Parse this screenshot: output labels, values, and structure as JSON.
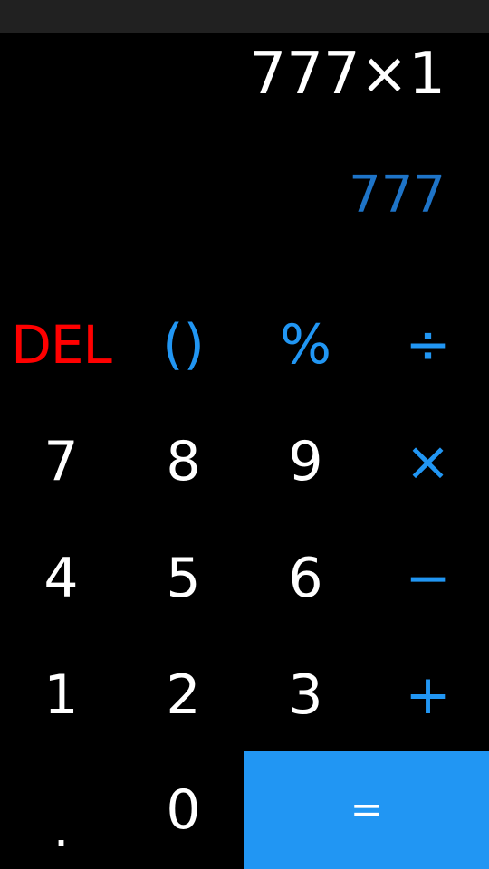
{
  "display": {
    "expression": "777×1",
    "result": "777"
  },
  "keypad": {
    "row1": [
      "DEL",
      "()",
      "%",
      "÷"
    ],
    "row2": [
      "7",
      "8",
      "9",
      "×"
    ],
    "row3": [
      "4",
      "5",
      "6",
      "−"
    ],
    "row4": [
      "1",
      "2",
      "3",
      "+"
    ],
    "row5": [
      ".",
      "0",
      "="
    ]
  },
  "colors": {
    "background": "#000000",
    "status_bar": "#212121",
    "digits": "#ffffff",
    "operators": "#2196f3",
    "result": "#1e74c8",
    "delete": "#ff0000",
    "equals_bg": "#2196f3"
  }
}
